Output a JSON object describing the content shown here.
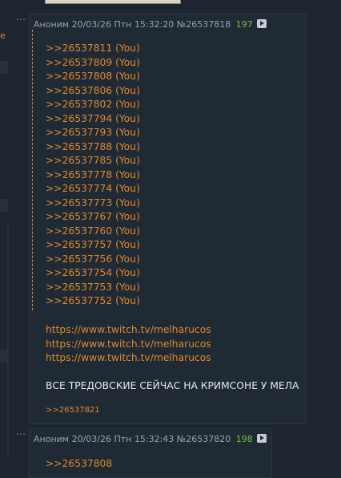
{
  "left": {
    "cut_text": "e"
  },
  "post1": {
    "author": "Аноним",
    "datetime": "20/03/26 Птн 15:32:20",
    "number": "№26537818",
    "count": "197",
    "replies": [
      ">>26537811 (You)",
      ">>26537809 (You)",
      ">>26537808 (You)",
      ">>26537806 (You)",
      ">>26537802 (You)",
      ">>26537794 (You)",
      ">>26537793 (You)",
      ">>26537788 (You)",
      ">>26537785 (You)",
      ">>26537778 (You)",
      ">>26537774 (You)",
      ">>26537773 (You)",
      ">>26537767 (You)",
      ">>26537760 (You)",
      ">>26537757 (You)",
      ">>26537756 (You)",
      ">>26537754 (You)",
      ">>26537753 (You)",
      ">>26537752 (You)"
    ],
    "links": [
      "https://www.twitch.tv/melharucos",
      "https://www.twitch.tv/melharucos",
      "https://www.twitch.tv/melharucos"
    ],
    "message": "ВСЕ ТРЕДОВСКИЕ СЕЙЧАС НА КРИМСОНЕ У МЕЛА",
    "backref": ">>26537821"
  },
  "post2": {
    "author": "Аноним",
    "datetime": "20/03/26 Птн 15:32:43",
    "number": "№26537820",
    "count": "198",
    "reply": ">>26537808"
  },
  "icons": {
    "menu": "more-dots-icon",
    "media": "play-icon"
  },
  "colors": {
    "reply_link": "#e0872d",
    "count": "#7bbf3a",
    "post_bg": "#1f2a35",
    "page_bg": "#1c2530"
  }
}
